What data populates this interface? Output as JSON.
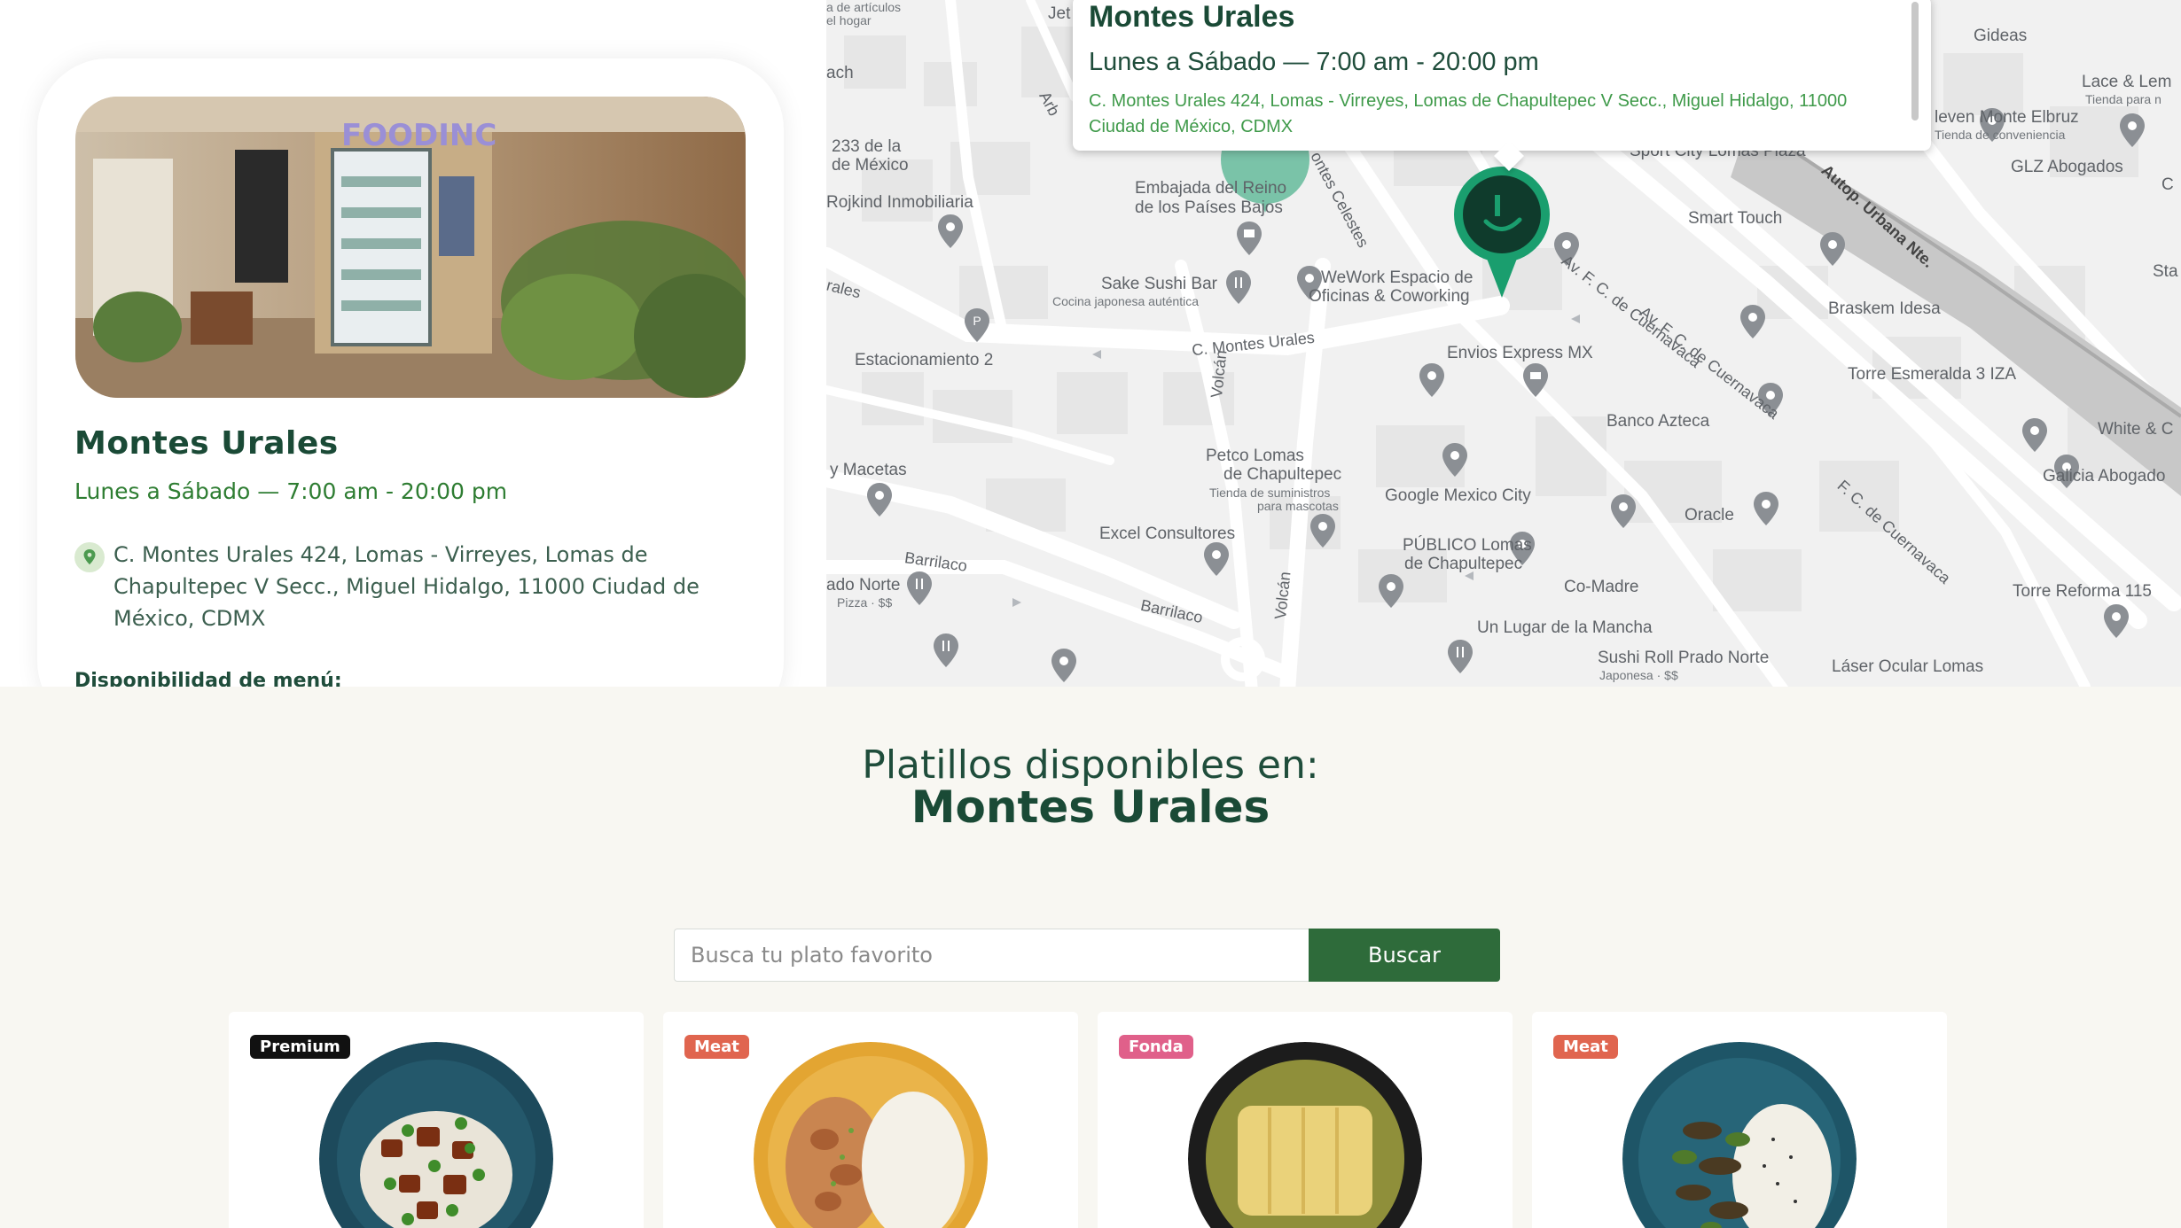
{
  "location_card": {
    "name": "Montes Urales",
    "hours": "Lunes a Sábado — 7:00 am - 20:00 pm",
    "address": "C. Montes Urales 424, Lomas - Virreyes, Lomas de Chapultepec V Secc., Miguel Hidalgo, 11000 Ciudad de México, CDMX",
    "menu_availability_label": "Disponibilidad de menú:",
    "photo_sign": "FOODINC"
  },
  "map": {
    "popup": {
      "title": "Montes Urales",
      "hours": "Lunes a Sábado — 7:00 am - 20:00 pm",
      "address": "C. Montes Urales 424, Lomas - Virreyes, Lomas de Chapultepec V Secc., Miguel Hidalgo, 11000 Ciudad de México, CDMX"
    },
    "places": {
      "articulos": "a de artículos",
      "hogar": "el hogar",
      "jet": "Jet",
      "ach": "ach",
      "mexico233a": "233 de la",
      "mexico233b": "de México",
      "rojkind": "Rojkind Inmobiliaria",
      "embajada_a": "Embajada del Reino",
      "embajada_b": "de los Países Bajos",
      "sake": "Sake Sushi Bar",
      "sake_sub": "Cocina japonesa auténtica",
      "wework_a": "WeWork Espacio de",
      "wework_b": "Oficinas & Coworking",
      "estacionamiento": "Estacionamiento 2",
      "envios": "Envios Express MX",
      "banco": "Banco Azteca",
      "macetas": "y Macetas",
      "petco_a": "Petco Lomas",
      "petco_b": "de Chapultepec",
      "petco_sub1": "Tienda de suministros",
      "petco_sub2": "para mascotas",
      "google": "Google Mexico City",
      "excel": "Excel Consultores",
      "publico_a": "PÚBLICO Lomas",
      "publico_b": "de Chapultepec",
      "comadre": "Co-Madre",
      "oracle": "Oracle",
      "lugar": "Un Lugar de la Mancha",
      "sushiroll": "Sushi Roll Prado Norte",
      "sushiroll_sub": "Japonesa · $$",
      "laser": "Láser Ocular Lomas",
      "pradonorte": "ado Norte",
      "pradonorte_sub": "Pizza · $$",
      "gideas": "Gideas",
      "lace": "Lace & Lem",
      "lace_sub": "Tienda para n",
      "eleven": "leven Monte Elbruz",
      "eleven_sub": "Tienda de conveniencia",
      "glz": "GLZ Abogados",
      "smarttouch": "Smart Touch",
      "sportcity": "Sport City Lomas Plaza",
      "braskem": "Braskem Idesa",
      "torre": "Torre Esmeralda 3 IZA",
      "white": "White & C",
      "galicia": "Galicia Abogado",
      "reforma": "Torre Reforma 115",
      "sta": "Sta",
      "c": "C"
    },
    "streets": {
      "montes_urales": "C. Montes Urales",
      "volcan1": "Volcán",
      "volcan2": "Volcán",
      "barrilaco1": "Barrilaco",
      "barrilaco2": "Barrilaco",
      "cuernavaca1": "Av. F. C. de Cuernavaca",
      "cuernavaca2": "Av. F. C. de Cuernavaca",
      "cuernavaca3": "F. C. de Cuernavaca",
      "autopista": "Autop. Urbana Nte.",
      "celestes": "ontes Celestes",
      "urales_left": "rales",
      "arb": "Arb"
    }
  },
  "dishes_section": {
    "heading_line1": "Platillos disponibles en:",
    "heading_line2": "Montes Urales"
  },
  "search": {
    "placeholder": "Busca tu plato favorito",
    "button_label": "Buscar"
  },
  "dishes": [
    {
      "badge": "Premium",
      "badge_color": "#111111"
    },
    {
      "badge": "Meat",
      "badge_color": "#e0654f"
    },
    {
      "badge": "Fonda",
      "badge_color": "#e0608a"
    },
    {
      "badge": "Meat",
      "badge_color": "#e0654f"
    }
  ],
  "colors": {
    "brand_green": "#1a4a36",
    "accent_green": "#2e6b3a",
    "marker_green": "#1a9e6e",
    "page_background": "#f8f7f2"
  }
}
